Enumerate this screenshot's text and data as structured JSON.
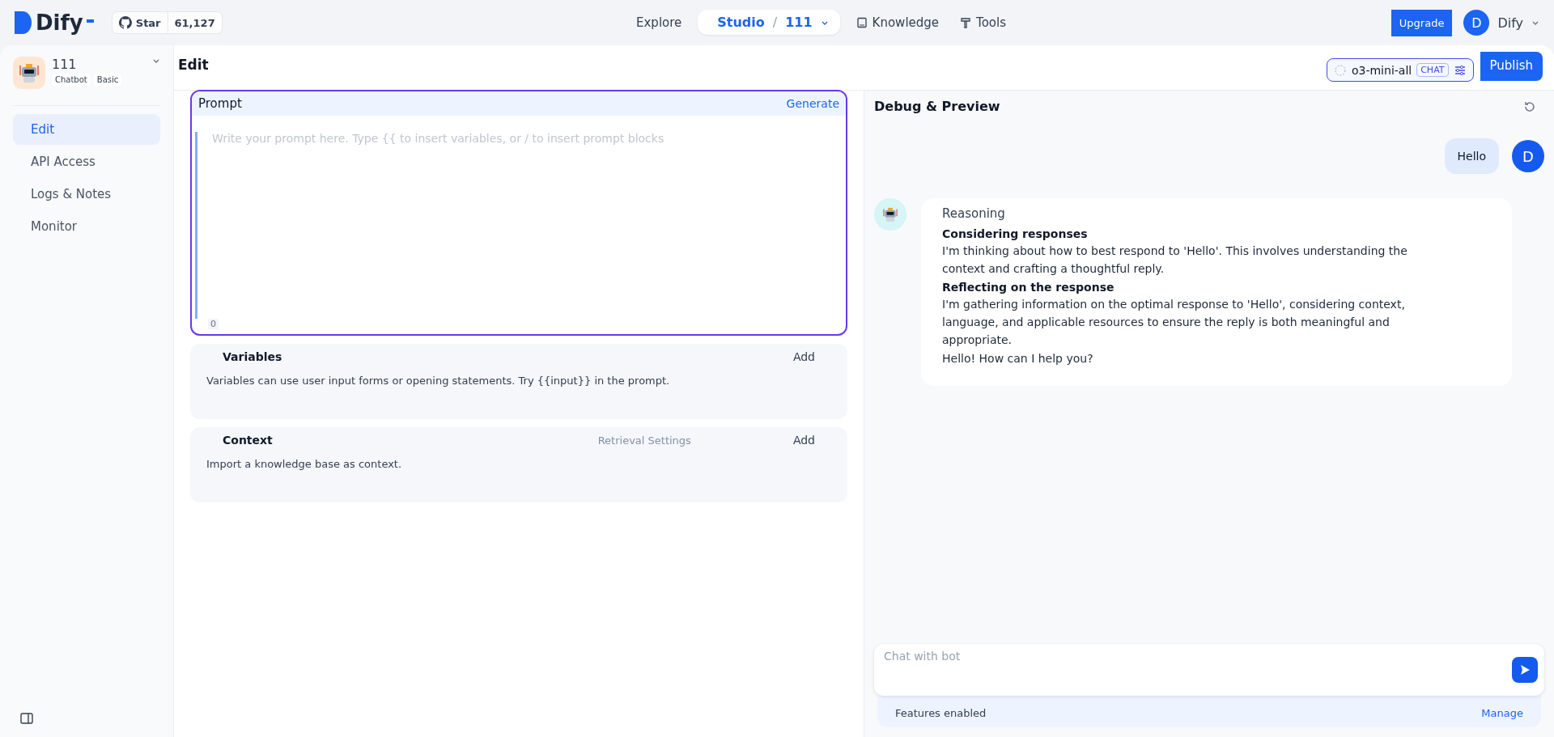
{
  "header": {
    "logo": "Dify",
    "github": {
      "label": "Star",
      "count": "61,127"
    },
    "nav": [
      {
        "label": "Explore",
        "selected": false,
        "kind": "link"
      },
      {
        "label": "Studio",
        "selected": true,
        "kind": "studio",
        "separator": "/",
        "crumb": "111"
      },
      {
        "label": "Knowledge",
        "selected": false,
        "kind": "link"
      },
      {
        "label": "Tools",
        "selected": false,
        "kind": "link"
      }
    ],
    "upgrade": "Upgrade",
    "user": {
      "initial": "D",
      "name": "Dify"
    }
  },
  "app": {
    "name": "111",
    "tags": [
      "Chatbot",
      "Basic"
    ]
  },
  "sidebar": {
    "items": [
      {
        "label": "Edit",
        "selected": true
      },
      {
        "label": "API Access",
        "selected": false
      },
      {
        "label": "Logs & Notes",
        "selected": false
      },
      {
        "label": "Monitor",
        "selected": false
      }
    ]
  },
  "editor": {
    "title": "Edit",
    "model": "o3-mini-all",
    "model_badge": "CHAT",
    "publish": "Publish",
    "prompt": {
      "label": "Prompt",
      "generate": "Generate",
      "placeholder": "Write your prompt here. Type {{ to insert variables, or / to insert prompt blocks",
      "count": "0"
    },
    "sections": [
      {
        "title": "Variables",
        "add": "Add",
        "description": "Variables can use user input forms or opening statements. Try {{input}} in the prompt."
      },
      {
        "title": "Context",
        "extra": "Retrieval Settings",
        "add": "Add",
        "description": "Import a knowledge base as context."
      }
    ]
  },
  "debug": {
    "title": "Debug & Preview",
    "messages": [
      {
        "kind": "user",
        "text": "Hello",
        "avatar": "D"
      },
      {
        "kind": "bot",
        "reasoning_label": "Reasoning",
        "steps": [
          {
            "heading": "Considering responses",
            "text": "I'm thinking about how to best respond to 'Hello'. This involves understanding the context and crafting a thoughtful reply."
          },
          {
            "heading": "Reflecting on the response",
            "text": "I'm gathering information on the optimal response to 'Hello', considering context, language, and applicable resources to ensure the reply is both meaningful and appropriate."
          }
        ],
        "answer": "Hello! How can I help you?"
      }
    ],
    "input": {
      "placeholder": "Chat with bot"
    },
    "features": {
      "label": "Features enabled",
      "manage": "Manage"
    }
  }
}
